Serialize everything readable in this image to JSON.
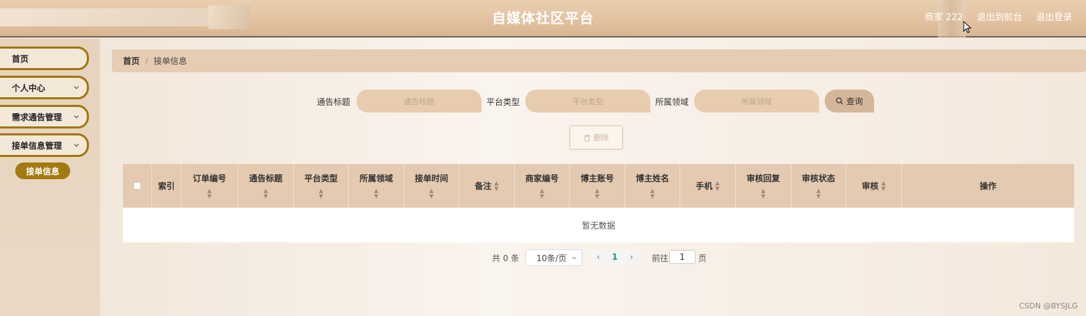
{
  "header": {
    "title": "自媒体社区平台",
    "user": "商家 222",
    "to_frontend": "退出到前台",
    "logout": "退出登录"
  },
  "sidebar": {
    "items": [
      {
        "label": "首页"
      },
      {
        "label": "个人中心"
      },
      {
        "label": "需求通告管理"
      },
      {
        "label": "接单信息管理"
      }
    ],
    "active_sub": "接单信息"
  },
  "breadcrumb": {
    "home": "首页",
    "separator": "/",
    "current": "接单信息"
  },
  "search": {
    "fields": [
      {
        "label": "通告标题",
        "placeholder": "通告标题"
      },
      {
        "label": "平台类型",
        "placeholder": "平台类型"
      },
      {
        "label": "所属领域",
        "placeholder": "所属领域"
      }
    ],
    "query_label": "查询"
  },
  "actions": {
    "delete_label": "删除"
  },
  "table": {
    "columns": [
      {
        "label": "索引"
      },
      {
        "label": "订单编号"
      },
      {
        "label": "通告标题"
      },
      {
        "label": "平台类型"
      },
      {
        "label": "所属领域"
      },
      {
        "label": "接单时间"
      },
      {
        "label": "备注"
      },
      {
        "label": "商家编号"
      },
      {
        "label": "博主账号"
      },
      {
        "label": "博主姓名"
      },
      {
        "label": "手机"
      },
      {
        "label": "审核回复"
      },
      {
        "label": "审核状态"
      },
      {
        "label": "审核"
      },
      {
        "label": "操作"
      }
    ],
    "empty_text": "暂无数据"
  },
  "pager": {
    "total": "共 0 条",
    "page_size": "10条/页",
    "current_page": "1",
    "goto_label": "前往",
    "goto_value": "1",
    "page_suffix": "页"
  },
  "watermark": "CSDN @BYSJLG",
  "colors": {
    "accent": "#a37a10",
    "header_bg": "#e2c19f",
    "table_header_bg": "#e3cab0"
  }
}
